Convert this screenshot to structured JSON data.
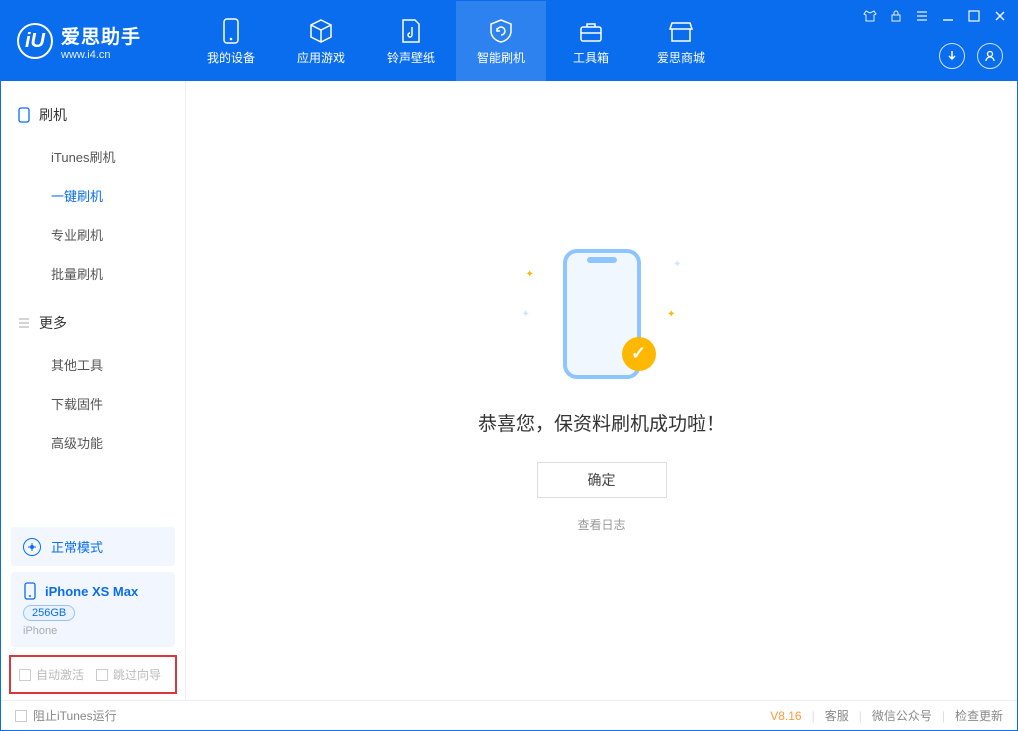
{
  "logo": {
    "title": "爱思助手",
    "subtitle": "www.i4.cn",
    "glyph": "iU"
  },
  "nav": [
    {
      "label": "我的设备",
      "icon": "device"
    },
    {
      "label": "应用游戏",
      "icon": "cube"
    },
    {
      "label": "铃声壁纸",
      "icon": "music"
    },
    {
      "label": "智能刷机",
      "icon": "refresh"
    },
    {
      "label": "工具箱",
      "icon": "toolbox"
    },
    {
      "label": "爱思商城",
      "icon": "store"
    }
  ],
  "nav_active_index": 3,
  "sidebar": {
    "section1": {
      "title": "刷机",
      "items": [
        "iTunes刷机",
        "一键刷机",
        "专业刷机",
        "批量刷机"
      ],
      "active_index": 1
    },
    "section2": {
      "title": "更多",
      "items": [
        "其他工具",
        "下载固件",
        "高级功能"
      ]
    }
  },
  "mode_card": {
    "label": "正常模式"
  },
  "device": {
    "name": "iPhone XS Max",
    "storage": "256GB",
    "type": "iPhone"
  },
  "highlight_checkboxes": {
    "cb1": "自动激活",
    "cb2": "跳过向导"
  },
  "main": {
    "success_text": "恭喜您，保资料刷机成功啦！",
    "ok_button": "确定",
    "view_log": "查看日志"
  },
  "statusbar": {
    "block_itunes": "阻止iTunes运行",
    "version": "V8.16",
    "links": [
      "客服",
      "微信公众号",
      "检查更新"
    ]
  }
}
